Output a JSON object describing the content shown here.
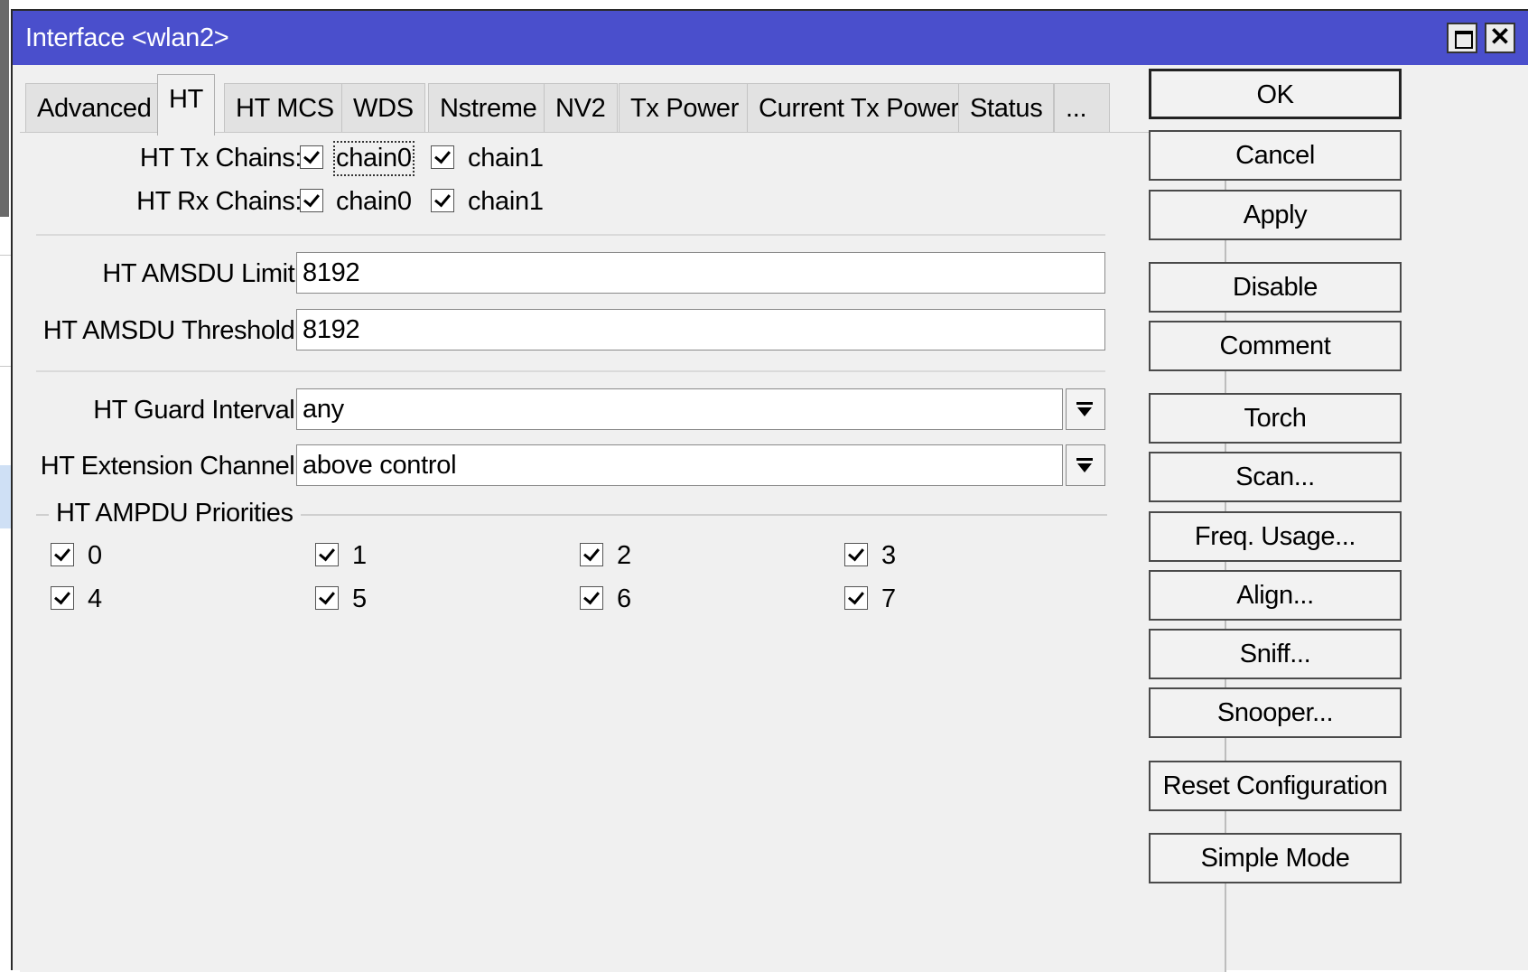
{
  "window": {
    "title": "Interface <wlan2>"
  },
  "tabs": [
    "Advanced",
    "HT",
    "HT MCS",
    "WDS",
    "Nstreme",
    "NV2",
    "Tx Power",
    "Current Tx Power",
    "Status",
    "..."
  ],
  "active_tab": "HT",
  "ht": {
    "tx_chains": {
      "label": "HT Tx Chains:",
      "chain0": "chain0",
      "chain1": "chain1",
      "chain0_checked": true,
      "chain1_checked": true
    },
    "rx_chains": {
      "label": "HT Rx Chains:",
      "chain0": "chain0",
      "chain1": "chain1",
      "chain0_checked": true,
      "chain1_checked": true
    },
    "amsdu_limit": {
      "label": "HT AMSDU Limit:",
      "value": "8192"
    },
    "amsdu_threshold": {
      "label": "HT AMSDU Threshold:",
      "value": "8192"
    },
    "guard_interval": {
      "label": "HT Guard Interval:",
      "value": "any"
    },
    "extension_channel": {
      "label": "HT Extension Channel:",
      "value": "above control"
    },
    "ampdu": {
      "title": "HT AMPDU Priorities",
      "priorities": [
        "0",
        "1",
        "2",
        "3",
        "4",
        "5",
        "6",
        "7"
      ],
      "all_checked": true
    }
  },
  "buttons": {
    "ok": "OK",
    "cancel": "Cancel",
    "apply": "Apply",
    "disable": "Disable",
    "comment": "Comment",
    "torch": "Torch",
    "scan": "Scan...",
    "freq_usage": "Freq. Usage...",
    "align": "Align...",
    "sniff": "Sniff...",
    "snooper": "Snooper...",
    "reset_configuration": "Reset Configuration",
    "simple_mode": "Simple Mode"
  },
  "colors": {
    "titlebar": "#4a4fcc",
    "window_bg": "#f0f0f0"
  }
}
